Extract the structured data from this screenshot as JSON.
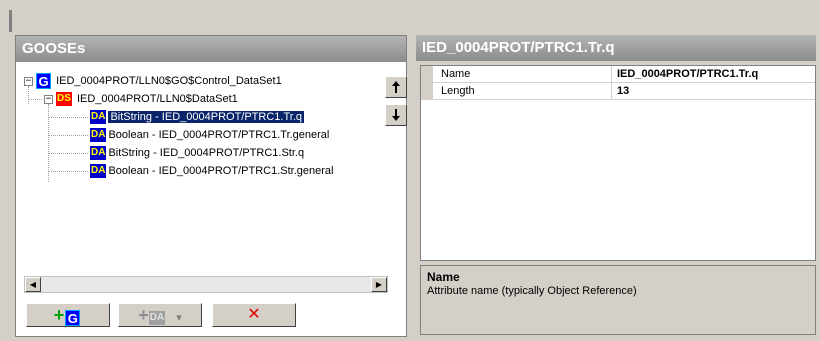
{
  "gooses_panel": {
    "title": "GOOSEs",
    "tree": {
      "goose": {
        "badge": "G",
        "label": "IED_0004PROT/LLN0$GO$Control_DataSet1",
        "expander": "−"
      },
      "dataset": {
        "badge": "DS",
        "label": "IED_0004PROT/LLN0$DataSet1",
        "expander": "−"
      },
      "attributes": [
        {
          "badge": "DA",
          "label": "BitString - IED_0004PROT/PTRC1.Tr.q",
          "selected": true
        },
        {
          "badge": "DA",
          "label": "Boolean - IED_0004PROT/PTRC1.Tr.general",
          "selected": false
        },
        {
          "badge": "DA",
          "label": "BitString - IED_0004PROT/PTRC1.Str.q",
          "selected": false
        },
        {
          "badge": "DA",
          "label": "Boolean - IED_0004PROT/PTRC1.Str.general",
          "selected": false
        }
      ]
    },
    "move_up_icon": "arrow-up-icon",
    "move_down_icon": "arrow-down-icon",
    "toolbar": {
      "add_goose": {
        "plus": "+",
        "badge": "G"
      },
      "add_da": {
        "plus": "+",
        "badge": "DA",
        "dropdown": "▾"
      },
      "delete": {
        "symbol": "✕"
      }
    }
  },
  "properties_panel": {
    "title": "IED_0004PROT/PTRC1.Tr.q",
    "rows": [
      {
        "name": "Name",
        "value": "IED_0004PROT/PTRC1.Tr.q"
      },
      {
        "name": "Length",
        "value": "13"
      }
    ],
    "description": {
      "title": "Name",
      "text": "Attribute name (typically Object Reference)"
    }
  },
  "colors": {
    "selection": "#0a246a",
    "goose_badge": "#0000ff",
    "dataset_badge": "#ff0000",
    "attribute_badge": "#0000c8",
    "add_icon": "#00a000",
    "delete_icon": "#e00000"
  }
}
